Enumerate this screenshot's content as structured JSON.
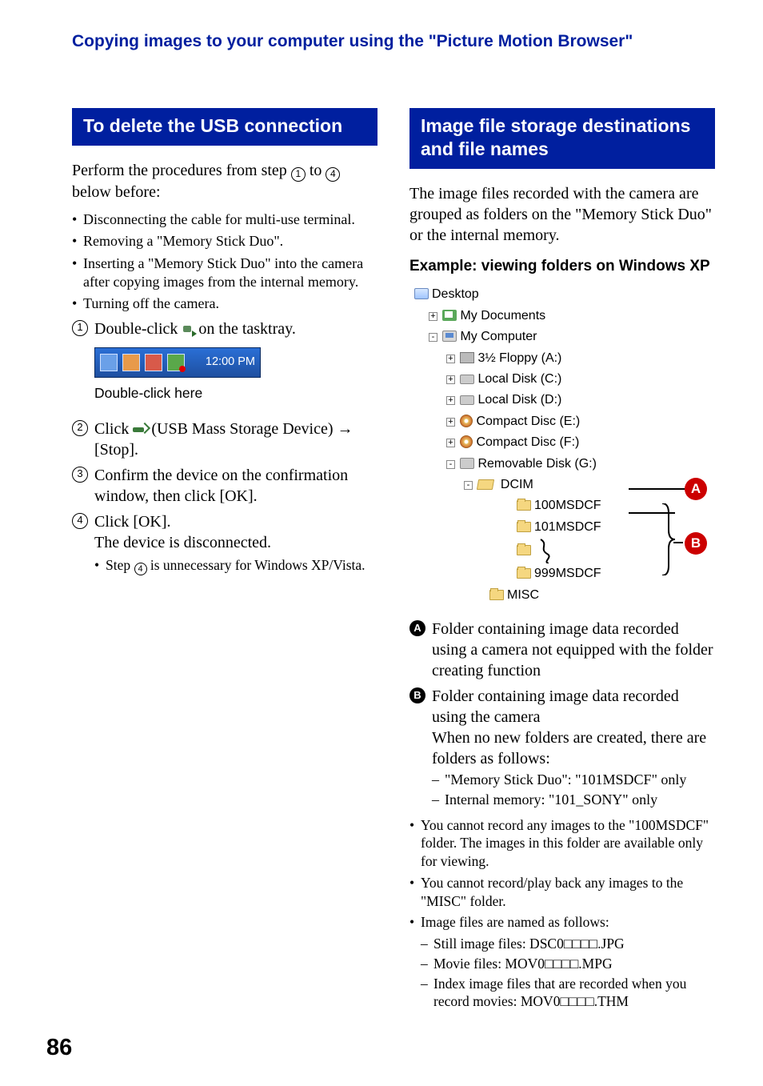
{
  "header": {
    "title": "Copying images to your computer using the \"Picture Motion Browser\""
  },
  "left": {
    "section_title": "To delete the USB connection",
    "intro_a": "Perform the procedures from step ",
    "intro_b": " to ",
    "intro_c": " below before:",
    "circ1": "1",
    "circ4": "4",
    "bullets": [
      "Disconnecting the cable for multi-use terminal.",
      "Removing a \"Memory Stick Duo\".",
      "Inserting a \"Memory Stick Duo\" into the camera after copying images from the internal memory.",
      "Turning off the camera."
    ],
    "step1_a": "Double-click ",
    "step1_b": " on the tasktray.",
    "tray_time": "12:00 PM",
    "caption": "Double-click here",
    "step2_a": "Click ",
    "step2_b": " (USB Mass Storage Device) → [Stop].",
    "step3": "Confirm the device on the confirmation window, then click [OK].",
    "step4_a": "Click [OK].",
    "step4_b": "The device is disconnected.",
    "step4_note_a": "Step ",
    "step4_note_b": " is unnecessary for Windows XP/Vista."
  },
  "right": {
    "section_title": "Image file storage destinations and file names",
    "intro": "The image files recorded with the camera are grouped as folders on the \"Memory Stick Duo\" or the internal memory.",
    "example_title": "Example: viewing folders on Windows XP",
    "tree": {
      "desktop": "Desktop",
      "mydocs": "My Documents",
      "mycomp": "My Computer",
      "floppy": "3½ Floppy (A:)",
      "diskc": "Local Disk (C:)",
      "diskd": "Local Disk (D:)",
      "cde": "Compact Disc (E:)",
      "cdf": "Compact Disc (F:)",
      "remg": "Removable Disk (G:)",
      "dcim": "DCIM",
      "f100": "100MSDCF",
      "f101": "101MSDCF",
      "f999": "999MSDCF",
      "misc": "MISC"
    },
    "badge_a": "A",
    "badge_b": "B",
    "desc_a": "Folder containing image data recorded using a camera not equipped with the folder creating function",
    "desc_b1": "Folder containing image data recorded using the camera",
    "desc_b2": "When no new folders are created, there are folders as follows:",
    "desc_b_dash": [
      "\"Memory Stick Duo\": \"101MSDCF\" only",
      "Internal memory: \"101_SONY\" only"
    ],
    "notes": [
      "You cannot record any images to the \"100MSDCF\" folder. The images in this folder are available only for viewing.",
      "You cannot record/play back any images to the \"MISC\" folder.",
      "Image files are named as follows:"
    ],
    "file_dash": [
      "Still image files: DSC0□□□□.JPG",
      "Movie files: MOV0□□□□.MPG",
      "Index image files that are recorded when you record movies: MOV0□□□□.THM"
    ]
  },
  "page": "86"
}
